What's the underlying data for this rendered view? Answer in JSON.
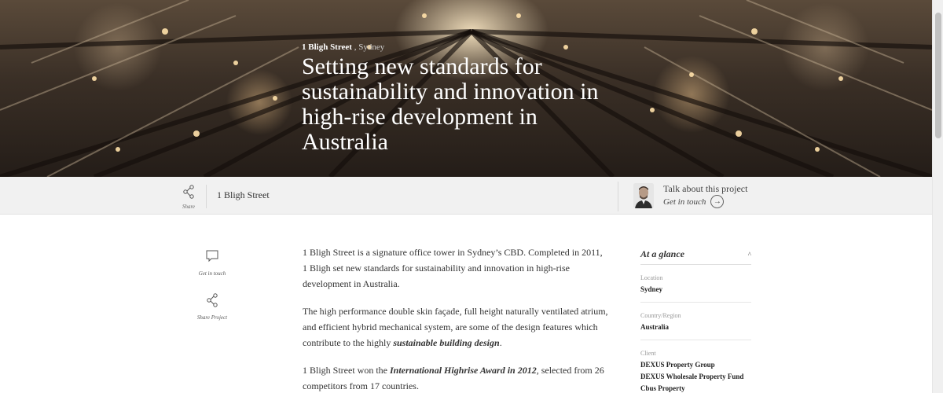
{
  "hero": {
    "project_name": "1 Bligh Street",
    "separator": ",",
    "city": "Sydney",
    "title": "Setting new standards for sustainability and innovation in high-rise development in Australia"
  },
  "bar": {
    "share_label": "Share",
    "project_title": "1 Bligh Street",
    "talk_label": "Talk about this project",
    "get_in_touch_label": "Get in touch",
    "arrow_icon": "→"
  },
  "actions": {
    "get_in_touch_label": "Get in touch",
    "share_project_label": "Share Project"
  },
  "content": {
    "p1": "1 Bligh Street is a signature office tower in Sydney’s CBD. Completed in 2011, 1 Bligh set new standards for sustainability and innovation in high-rise development in Australia.",
    "p2_before": "The high performance double skin façade, full height naturally ventilated atrium, and efficient hybrid mechanical system, are some of the design features which contribute to the highly ",
    "p2_em": "sustainable building design",
    "p2_after": ".",
    "p3_before": "1 Bligh Street won the ",
    "p3_em": "International Highrise Award in 2012",
    "p3_after": ", selected from 26 competitors from 17 countries."
  },
  "glance": {
    "title": "At a glance",
    "chevron": "^",
    "location_label": "Location",
    "location_value": "Sydney",
    "country_label": "Country/Region",
    "country_value": "Australia",
    "client_label": "Client",
    "client_values": [
      "DEXUS Property Group",
      "DEXUS Wholesale Property Fund",
      "Cbus Property"
    ]
  },
  "colors": {
    "bar_bg": "#f1f1f1",
    "text": "#333333",
    "hero_text": "#ffffff"
  }
}
